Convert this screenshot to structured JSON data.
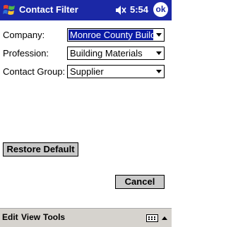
{
  "titlebar": {
    "title": "Contact Filter",
    "time": "5:54",
    "ok_label": "ok"
  },
  "form": {
    "company": {
      "label": "Company:",
      "value": "Monroe County Buildir"
    },
    "profession": {
      "label": "Profession:",
      "value": "Building Materials"
    },
    "group": {
      "label": "Contact Group:",
      "value": "Supplier"
    }
  },
  "buttons": {
    "restore": "Restore Default",
    "cancel": "Cancel"
  },
  "menubar": {
    "items": [
      "Edit",
      "View",
      "Tools"
    ]
  },
  "colors": {
    "titlebar": "#1b28a6",
    "selection": "#0a1aa5",
    "button_face": "#c9c9c9"
  },
  "icons": {
    "start": "windows-start-icon",
    "volume": "speaker-icon",
    "sip": "keyboard-icon"
  }
}
